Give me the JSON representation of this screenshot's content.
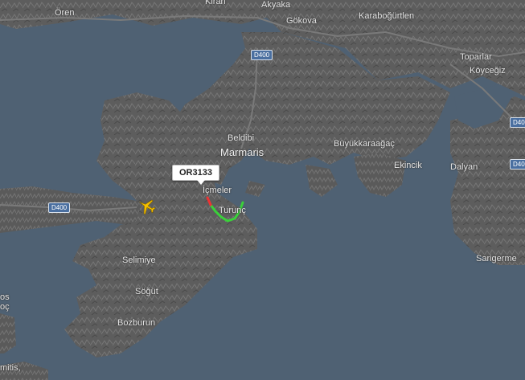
{
  "map": {
    "colors": {
      "sea": "#4f6173",
      "land": "#5c5c5c",
      "flight_track": "#3ad13a",
      "aircraft": "#f5c000"
    },
    "places": [
      {
        "id": "oren",
        "name": "Ören"
      },
      {
        "id": "kiran",
        "name": "Kiran"
      },
      {
        "id": "akyaka",
        "name": "Akyaka"
      },
      {
        "id": "gokova",
        "name": "Gökova"
      },
      {
        "id": "karabogurtlen",
        "name": "Karaboğürtlen"
      },
      {
        "id": "toparlar",
        "name": "Toparlar"
      },
      {
        "id": "koycegiz",
        "name": "Köyceğiz"
      },
      {
        "id": "beldibi",
        "name": "Beldibi"
      },
      {
        "id": "marmaris",
        "name": "Marmaris"
      },
      {
        "id": "buyukkaraagac",
        "name": "Büyükkaraağaç"
      },
      {
        "id": "ekincik",
        "name": "Ekincik"
      },
      {
        "id": "dalyan",
        "name": "Dalyan"
      },
      {
        "id": "icmeler",
        "name": "İçmeler"
      },
      {
        "id": "turunc",
        "name": "Turunç"
      },
      {
        "id": "selimiye",
        "name": "Selimiye"
      },
      {
        "id": "sogut",
        "name": "Söğüt"
      },
      {
        "id": "bozburun",
        "name": "Bozburun"
      },
      {
        "id": "sarigerme",
        "name": "Sarigerme"
      },
      {
        "id": "left-edge-1",
        "name": "os"
      },
      {
        "id": "left-edge-2",
        "name": "oç"
      },
      {
        "id": "left-edge-3",
        "name": "mitis,"
      }
    ],
    "roads": [
      {
        "id": "d400-north",
        "label": "D400"
      },
      {
        "id": "d400-west",
        "label": "D400"
      },
      {
        "id": "d400-east",
        "label": "D400"
      },
      {
        "id": "d400-east2",
        "label": "D400"
      }
    ],
    "flight": {
      "callsign": "OR3133",
      "aircraft_icon": "airplane-icon"
    }
  }
}
